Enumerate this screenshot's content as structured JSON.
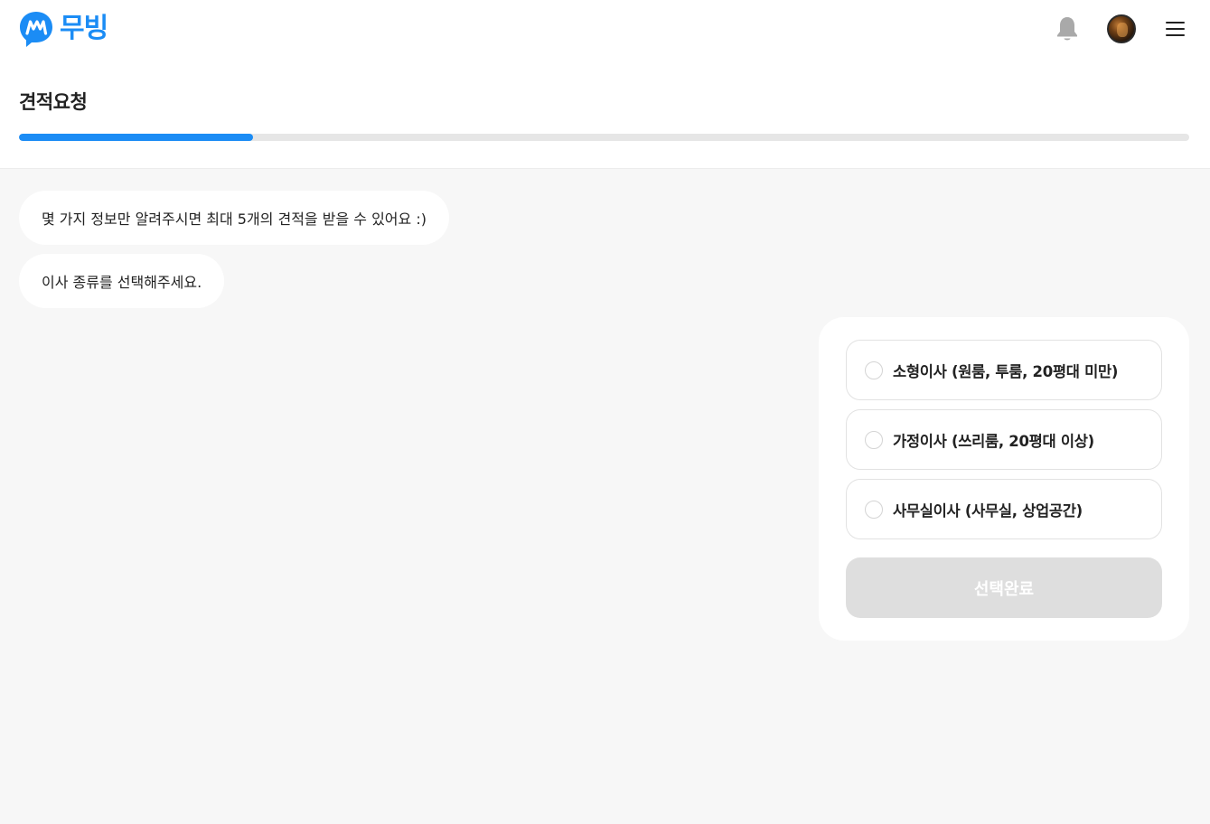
{
  "header": {
    "logo_text": "무빙",
    "icons": {
      "logo": "chat-bubble-m-logo",
      "bell": "bell-icon",
      "avatar": "user-avatar",
      "menu": "hamburger-menu-icon"
    },
    "brand_color": "#1b8cf5"
  },
  "page": {
    "title": "견적요청",
    "progress": 0.2
  },
  "chat": {
    "messages": [
      "몇 가지 정보만 알려주시면 최대 5개의 견적을 받을 수 있어요 :)",
      "이사 종류를 선택해주세요."
    ]
  },
  "options": [
    {
      "label": "소형이사 (원룸, 투룸, 20평대 미만)",
      "selected": false
    },
    {
      "label": "가정이사 (쓰리룸, 20평대 이상)",
      "selected": false
    },
    {
      "label": "사무실이사 (사무실, 상업공간)",
      "selected": false
    }
  ],
  "submit": {
    "label": "선택완료",
    "disabled": true,
    "disabled_color": "#dedede"
  }
}
